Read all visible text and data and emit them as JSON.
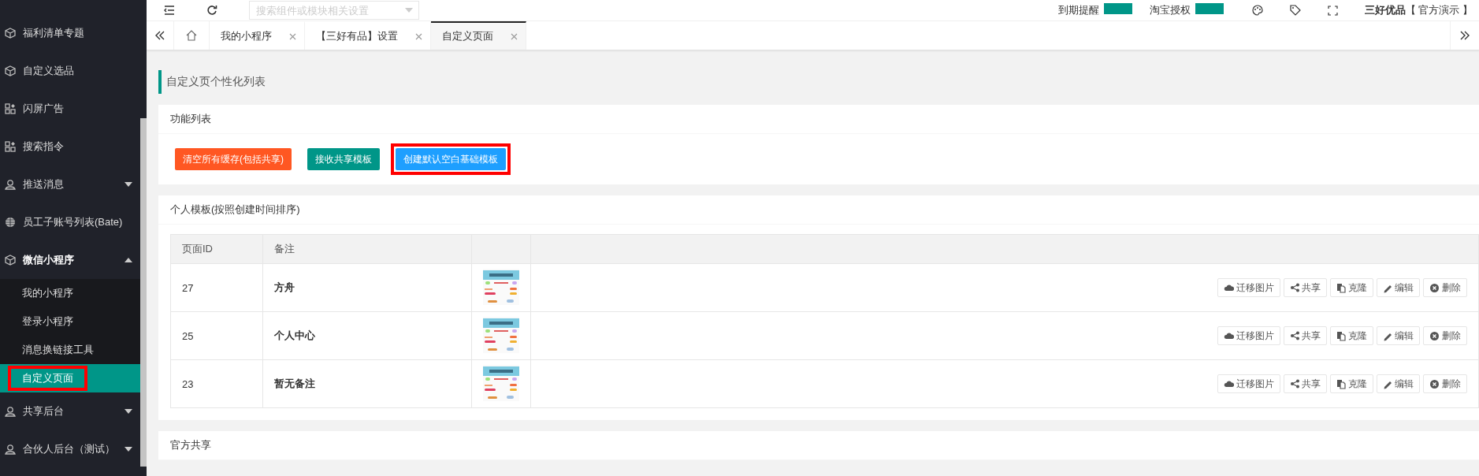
{
  "topbar": {
    "search": {
      "placeholder": "搜索组件或模块相关设置"
    },
    "notices": [
      "到期提醒",
      "淘宝授权"
    ],
    "user": "**三好优品**【 官方演示 】"
  },
  "sidebar": {
    "items": [
      {
        "label": "福利清单专题",
        "kind": "cube"
      },
      {
        "label": "自定义选品",
        "kind": "cube"
      },
      {
        "label": "闪屏广告",
        "kind": "apps"
      },
      {
        "label": "搜索指令",
        "kind": "apps"
      },
      {
        "label": "推送消息",
        "kind": "user",
        "expanded": false
      },
      {
        "label": "员工子账号列表(Bate)",
        "kind": "globe"
      },
      {
        "label": "微信小程序",
        "kind": "cube",
        "expanded": true,
        "children": [
          {
            "label": "我的小程序",
            "selected": false,
            "highlighted": false
          },
          {
            "label": "登录小程序",
            "selected": false,
            "highlighted": false
          },
          {
            "label": "消息换链接工具",
            "selected": false,
            "highlighted": false
          },
          {
            "label": "自定义页面",
            "selected": true,
            "highlighted": true
          }
        ]
      },
      {
        "label": "共享后台",
        "kind": "user",
        "expanded": false
      },
      {
        "label": "合伙人后台（测试）",
        "kind": "user",
        "expanded": false
      }
    ]
  },
  "tabs": [
    {
      "label": "我的小程序",
      "selected": false
    },
    {
      "label": "【三好有品】设置",
      "selected": false
    },
    {
      "label": "自定义页面",
      "selected": true
    }
  ],
  "page_title": "自定义页个性化列表",
  "function_panel": {
    "title": "功能列表",
    "buttons": [
      {
        "label": "清空所有缓存(包括共享)",
        "color": "#ff5722",
        "highlighted": false
      },
      {
        "label": "接收共享模板",
        "color": "#009688",
        "highlighted": false
      },
      {
        "label": "创建默认空白基础模板",
        "color": "#1e9fff",
        "highlighted": true
      }
    ]
  },
  "templates": {
    "title": "个人模板(按照创建时间排序)",
    "columns": [
      "页面ID",
      "备注"
    ],
    "rows": [
      {
        "id": "27",
        "note": "方舟",
        "actions": [
          {
            "kind": "cloud",
            "label": "迁移图片"
          },
          {
            "kind": "share",
            "label": "共享"
          },
          {
            "kind": "copy",
            "label": "克隆"
          },
          {
            "kind": "edit",
            "label": "编辑"
          },
          {
            "kind": "delete",
            "label": "删除"
          }
        ]
      },
      {
        "id": "25",
        "note": "个人中心",
        "actions": [
          {
            "kind": "cloud",
            "label": "迁移图片"
          },
          {
            "kind": "share",
            "label": "共享"
          },
          {
            "kind": "copy",
            "label": "克隆"
          },
          {
            "kind": "edit",
            "label": "编辑"
          },
          {
            "kind": "delete",
            "label": "删除"
          }
        ]
      },
      {
        "id": "23",
        "note": "暂无备注",
        "actions": [
          {
            "kind": "cloud",
            "label": "迁移图片"
          },
          {
            "kind": "share",
            "label": "共享"
          },
          {
            "kind": "copy",
            "label": "克隆"
          },
          {
            "kind": "edit",
            "label": "编辑"
          },
          {
            "kind": "delete",
            "label": "删除"
          }
        ]
      }
    ]
  },
  "shared": {
    "title": "官方共享"
  }
}
